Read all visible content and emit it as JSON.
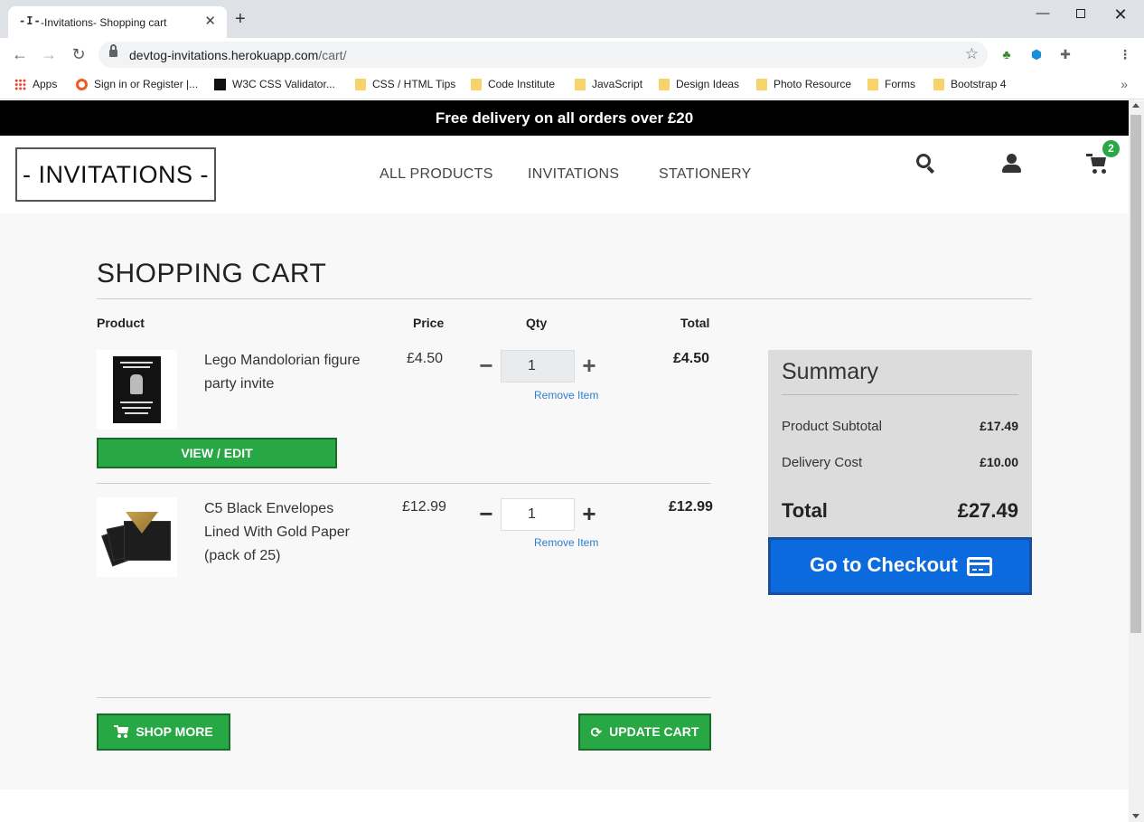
{
  "browser": {
    "tab_favicon": "-I-",
    "tab_title": "-Invitations- Shopping cart",
    "url_host": "devtog-invitations.herokuapp.com",
    "url_path": "/cart/",
    "bookmarks": [
      {
        "label": "Apps",
        "icon": "apps-icon"
      },
      {
        "label": "Sign in or Register |...",
        "icon": "circle-icon"
      },
      {
        "label": "W3C CSS Validator...",
        "icon": "w3c-icon"
      },
      {
        "label": "CSS / HTML Tips",
        "icon": "folder-icon"
      },
      {
        "label": "Code Institute",
        "icon": "folder-icon"
      },
      {
        "label": "JavaScript",
        "icon": "folder-icon"
      },
      {
        "label": "Design Ideas",
        "icon": "folder-icon"
      },
      {
        "label": "Photo Resource",
        "icon": "folder-icon"
      },
      {
        "label": "Forms",
        "icon": "folder-icon"
      },
      {
        "label": "Bootstrap 4",
        "icon": "folder-icon"
      }
    ]
  },
  "site": {
    "promo": "Free delivery on all orders over £20",
    "logo": "- INVITATIONS -",
    "nav": [
      "ALL PRODUCTS",
      "INVITATIONS",
      "STATIONERY"
    ],
    "cart_count": "2"
  },
  "cart": {
    "title": "SHOPPING CART",
    "columns": {
      "product": "Product",
      "price": "Price",
      "qty": "Qty",
      "total": "Total"
    },
    "items": [
      {
        "name": "Lego Mandolorian figure party invite",
        "price": "£4.50",
        "qty": "1",
        "total": "£4.50",
        "remove": "Remove Item",
        "action": "VIEW / EDIT"
      },
      {
        "name": "C5 Black Envelopes Lined With Gold Paper (pack of 25)",
        "price": "£12.99",
        "qty": "1",
        "total": "£12.99",
        "remove": "Remove Item"
      }
    ],
    "shop_more": "SHOP MORE",
    "update_cart": "UPDATE CART"
  },
  "summary": {
    "title": "Summary",
    "subtotal_label": "Product Subtotal",
    "subtotal": "£17.49",
    "delivery_label": "Delivery Cost",
    "delivery": "£10.00",
    "total_label": "Total",
    "total": "£27.49",
    "checkout": "Go to Checkout"
  },
  "colors": {
    "accent_green": "#28a745",
    "checkout_blue": "#0b6bde",
    "link_blue": "#2c7fcb"
  }
}
